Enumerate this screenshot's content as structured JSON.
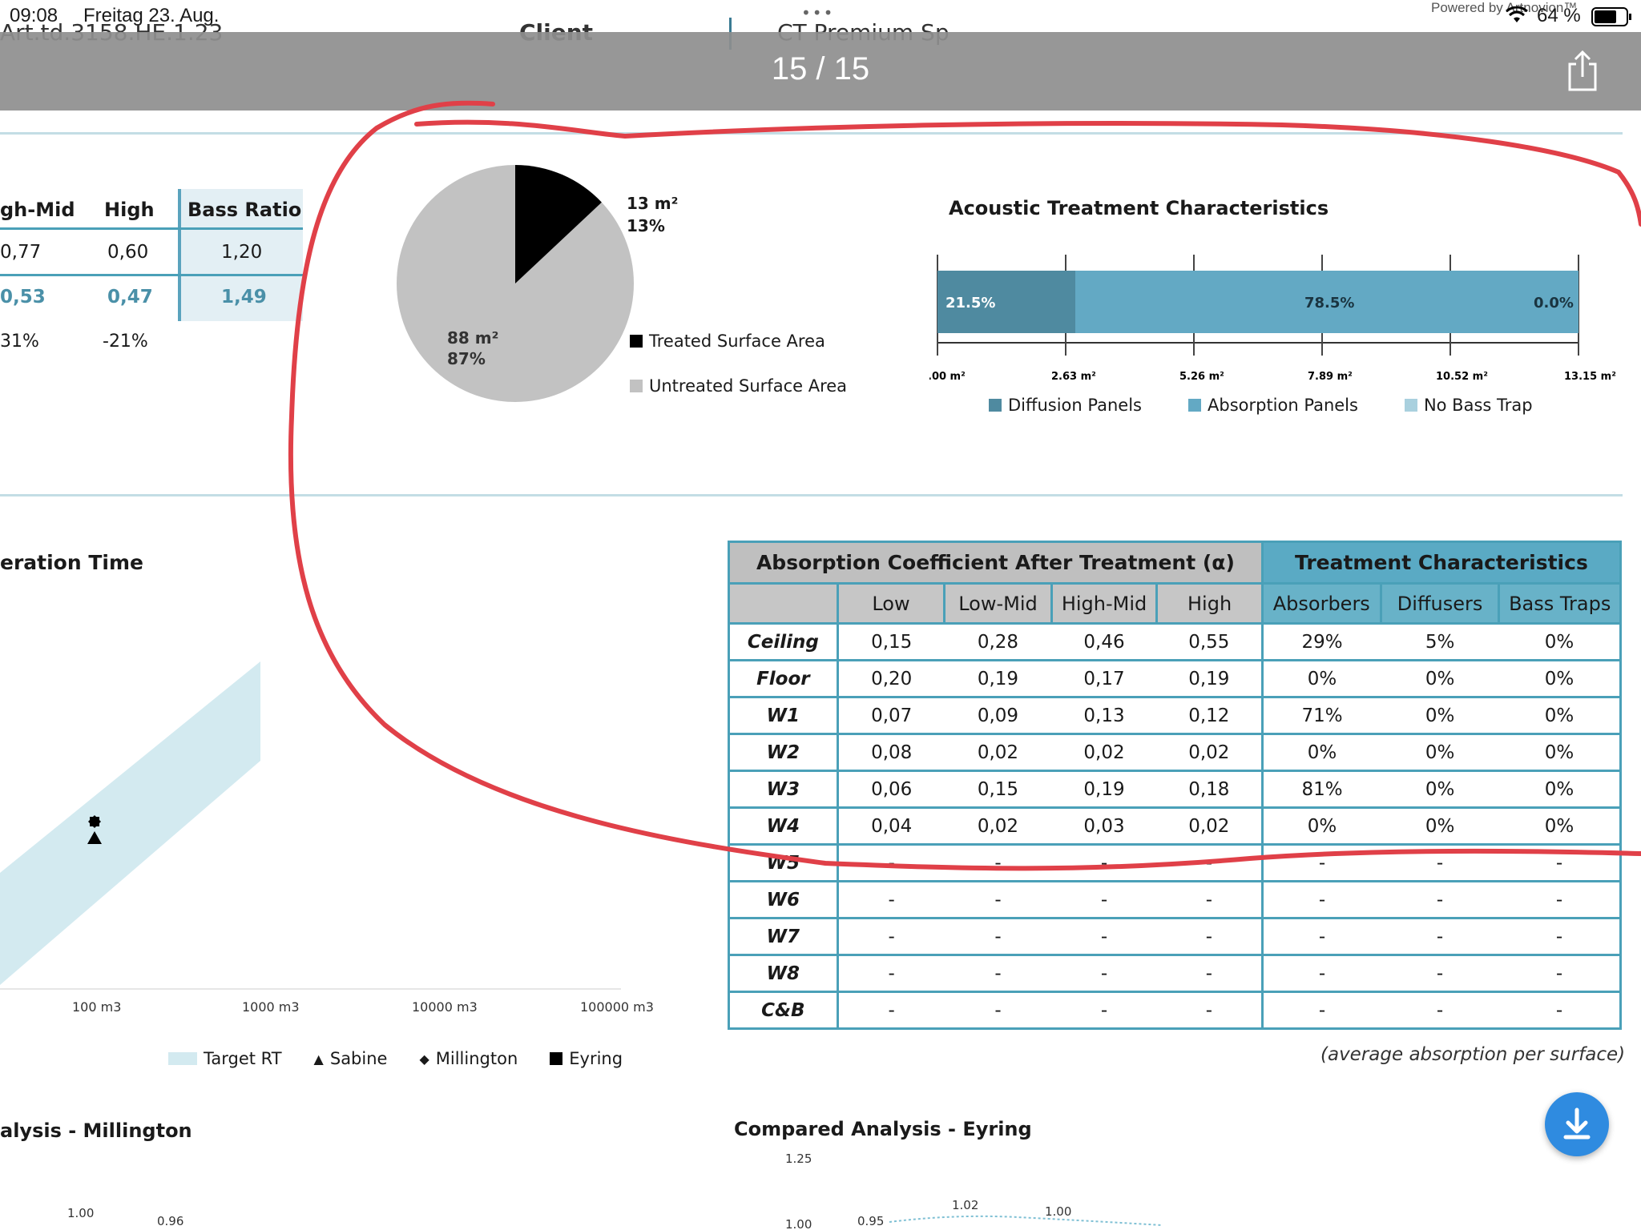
{
  "status": {
    "time": "09:08",
    "date": "Freitag 23. Aug.",
    "battery": "64 %",
    "powered": "Powered by Artnovion™",
    "icons": [
      "wifi-icon",
      "battery-icon"
    ]
  },
  "doc_header": {
    "ref": "Art.td.3158.HE.1.23",
    "client_label": "Client",
    "client_value": "CT Premium Sp",
    "page": "15 / 15",
    "more": "•••"
  },
  "summary_table": {
    "headers": [
      "gh-Mid",
      "High",
      "Bass Ratio"
    ],
    "row1": [
      "0,77",
      "0,60",
      "1,20"
    ],
    "row2": [
      "0,53",
      "0,47",
      "1,49"
    ],
    "row3": [
      "31%",
      "-21%"
    ]
  },
  "pie": {
    "treated_value": "13 m²",
    "treated_pct": "13%",
    "untreated_value": "88 m²",
    "untreated_pct": "87%",
    "treated_fraction": 0.13,
    "legend_treated": "Treated Surface Area",
    "legend_untreated": "Untreated Surface Area",
    "colors": {
      "treated": "#000000",
      "untreated": "#c2c2c2"
    }
  },
  "acoustic_chart": {
    "title": "Acoustic Treatment Characteristics",
    "segments": [
      {
        "label": "21.5%",
        "value": 21.5,
        "color": "#4f8aa0"
      },
      {
        "label": "78.5%",
        "value": 78.5,
        "color": "#63a9c4"
      },
      {
        "label": "0.0%",
        "value": 0.0,
        "color": "#a9d0de"
      }
    ],
    "ticks": [
      ".00 m²",
      "2.63 m²",
      "5.26 m²",
      "7.89 m²",
      "10.52 m²",
      "13.15 m²"
    ],
    "legend": [
      "Diffusion Panels",
      "Absorption Panels",
      "No Bass Trap"
    ]
  },
  "rt_chart": {
    "title": "eration Time",
    "xticks": [
      "100 m3",
      "1000 m3",
      "10000 m3",
      "100000 m3"
    ],
    "legend": [
      "Target RT",
      "Sabine",
      "Millington",
      "Eyring"
    ]
  },
  "abs_table": {
    "title_left": "Absorption Coefficient After Treatment (α)",
    "title_right": "Treatment Characteristics",
    "cols_left": [
      "Low",
      "Low-Mid",
      "High-Mid",
      "High"
    ],
    "cols_right": [
      "Absorbers",
      "Diffusers",
      "Bass Traps"
    ],
    "rows": [
      [
        "Ceiling",
        "0,15",
        "0,28",
        "0,46",
        "0,55",
        "29%",
        "5%",
        "0%"
      ],
      [
        "Floor",
        "0,20",
        "0,19",
        "0,17",
        "0,19",
        "0%",
        "0%",
        "0%"
      ],
      [
        "W1",
        "0,07",
        "0,09",
        "0,13",
        "0,12",
        "71%",
        "0%",
        "0%"
      ],
      [
        "W2",
        "0,08",
        "0,02",
        "0,02",
        "0,02",
        "0%",
        "0%",
        "0%"
      ],
      [
        "W3",
        "0,06",
        "0,15",
        "0,19",
        "0,18",
        "81%",
        "0%",
        "0%"
      ],
      [
        "W4",
        "0,04",
        "0,02",
        "0,03",
        "0,02",
        "0%",
        "0%",
        "0%"
      ],
      [
        "W5",
        "-",
        "-",
        "-",
        "-",
        "-",
        "-",
        "-"
      ],
      [
        "W6",
        "-",
        "-",
        "-",
        "-",
        "-",
        "-",
        "-"
      ],
      [
        "W7",
        "-",
        "-",
        "-",
        "-",
        "-",
        "-",
        "-"
      ],
      [
        "W8",
        "-",
        "-",
        "-",
        "-",
        "-",
        "-",
        "-"
      ],
      [
        "C&B",
        "-",
        "-",
        "-",
        "-",
        "-",
        "-",
        "-"
      ]
    ],
    "note": "(average absorption per surface)"
  },
  "bottom": {
    "left_title": "alysis - Millington",
    "left_values": [
      "1.00",
      "0.96"
    ],
    "right_title": "Compared Analysis - Eyring",
    "right_values": [
      "1.25",
      "1.02",
      "1.00",
      "1.00",
      "0.95"
    ]
  },
  "fab_icon": "download-icon",
  "annotation_color": "#e04048"
}
